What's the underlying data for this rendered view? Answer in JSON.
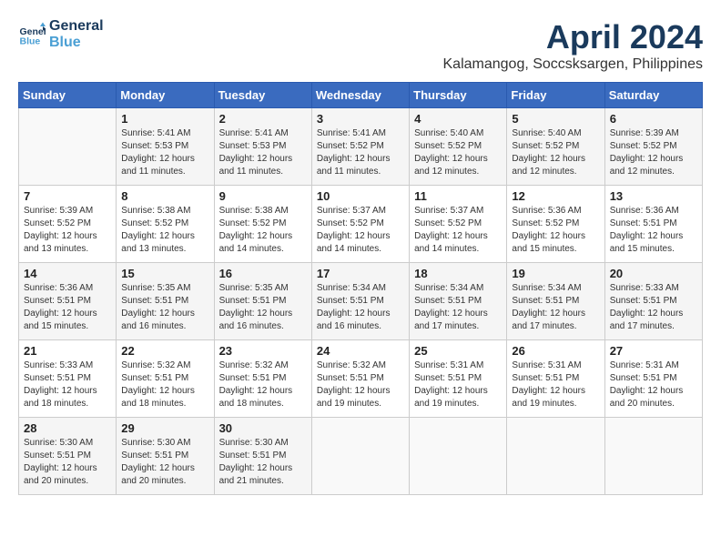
{
  "header": {
    "logo_line1": "General",
    "logo_line2": "Blue",
    "month_year": "April 2024",
    "location": "Kalamangog, Soccsksargen, Philippines"
  },
  "weekdays": [
    "Sunday",
    "Monday",
    "Tuesday",
    "Wednesday",
    "Thursday",
    "Friday",
    "Saturday"
  ],
  "weeks": [
    [
      {
        "day": "",
        "sunrise": "",
        "sunset": "",
        "daylight": ""
      },
      {
        "day": "1",
        "sunrise": "Sunrise: 5:41 AM",
        "sunset": "Sunset: 5:53 PM",
        "daylight": "Daylight: 12 hours and 11 minutes."
      },
      {
        "day": "2",
        "sunrise": "Sunrise: 5:41 AM",
        "sunset": "Sunset: 5:53 PM",
        "daylight": "Daylight: 12 hours and 11 minutes."
      },
      {
        "day": "3",
        "sunrise": "Sunrise: 5:41 AM",
        "sunset": "Sunset: 5:52 PM",
        "daylight": "Daylight: 12 hours and 11 minutes."
      },
      {
        "day": "4",
        "sunrise": "Sunrise: 5:40 AM",
        "sunset": "Sunset: 5:52 PM",
        "daylight": "Daylight: 12 hours and 12 minutes."
      },
      {
        "day": "5",
        "sunrise": "Sunrise: 5:40 AM",
        "sunset": "Sunset: 5:52 PM",
        "daylight": "Daylight: 12 hours and 12 minutes."
      },
      {
        "day": "6",
        "sunrise": "Sunrise: 5:39 AM",
        "sunset": "Sunset: 5:52 PM",
        "daylight": "Daylight: 12 hours and 12 minutes."
      }
    ],
    [
      {
        "day": "7",
        "sunrise": "Sunrise: 5:39 AM",
        "sunset": "Sunset: 5:52 PM",
        "daylight": "Daylight: 12 hours and 13 minutes."
      },
      {
        "day": "8",
        "sunrise": "Sunrise: 5:38 AM",
        "sunset": "Sunset: 5:52 PM",
        "daylight": "Daylight: 12 hours and 13 minutes."
      },
      {
        "day": "9",
        "sunrise": "Sunrise: 5:38 AM",
        "sunset": "Sunset: 5:52 PM",
        "daylight": "Daylight: 12 hours and 14 minutes."
      },
      {
        "day": "10",
        "sunrise": "Sunrise: 5:37 AM",
        "sunset": "Sunset: 5:52 PM",
        "daylight": "Daylight: 12 hours and 14 minutes."
      },
      {
        "day": "11",
        "sunrise": "Sunrise: 5:37 AM",
        "sunset": "Sunset: 5:52 PM",
        "daylight": "Daylight: 12 hours and 14 minutes."
      },
      {
        "day": "12",
        "sunrise": "Sunrise: 5:36 AM",
        "sunset": "Sunset: 5:52 PM",
        "daylight": "Daylight: 12 hours and 15 minutes."
      },
      {
        "day": "13",
        "sunrise": "Sunrise: 5:36 AM",
        "sunset": "Sunset: 5:51 PM",
        "daylight": "Daylight: 12 hours and 15 minutes."
      }
    ],
    [
      {
        "day": "14",
        "sunrise": "Sunrise: 5:36 AM",
        "sunset": "Sunset: 5:51 PM",
        "daylight": "Daylight: 12 hours and 15 minutes."
      },
      {
        "day": "15",
        "sunrise": "Sunrise: 5:35 AM",
        "sunset": "Sunset: 5:51 PM",
        "daylight": "Daylight: 12 hours and 16 minutes."
      },
      {
        "day": "16",
        "sunrise": "Sunrise: 5:35 AM",
        "sunset": "Sunset: 5:51 PM",
        "daylight": "Daylight: 12 hours and 16 minutes."
      },
      {
        "day": "17",
        "sunrise": "Sunrise: 5:34 AM",
        "sunset": "Sunset: 5:51 PM",
        "daylight": "Daylight: 12 hours and 16 minutes."
      },
      {
        "day": "18",
        "sunrise": "Sunrise: 5:34 AM",
        "sunset": "Sunset: 5:51 PM",
        "daylight": "Daylight: 12 hours and 17 minutes."
      },
      {
        "day": "19",
        "sunrise": "Sunrise: 5:34 AM",
        "sunset": "Sunset: 5:51 PM",
        "daylight": "Daylight: 12 hours and 17 minutes."
      },
      {
        "day": "20",
        "sunrise": "Sunrise: 5:33 AM",
        "sunset": "Sunset: 5:51 PM",
        "daylight": "Daylight: 12 hours and 17 minutes."
      }
    ],
    [
      {
        "day": "21",
        "sunrise": "Sunrise: 5:33 AM",
        "sunset": "Sunset: 5:51 PM",
        "daylight": "Daylight: 12 hours and 18 minutes."
      },
      {
        "day": "22",
        "sunrise": "Sunrise: 5:32 AM",
        "sunset": "Sunset: 5:51 PM",
        "daylight": "Daylight: 12 hours and 18 minutes."
      },
      {
        "day": "23",
        "sunrise": "Sunrise: 5:32 AM",
        "sunset": "Sunset: 5:51 PM",
        "daylight": "Daylight: 12 hours and 18 minutes."
      },
      {
        "day": "24",
        "sunrise": "Sunrise: 5:32 AM",
        "sunset": "Sunset: 5:51 PM",
        "daylight": "Daylight: 12 hours and 19 minutes."
      },
      {
        "day": "25",
        "sunrise": "Sunrise: 5:31 AM",
        "sunset": "Sunset: 5:51 PM",
        "daylight": "Daylight: 12 hours and 19 minutes."
      },
      {
        "day": "26",
        "sunrise": "Sunrise: 5:31 AM",
        "sunset": "Sunset: 5:51 PM",
        "daylight": "Daylight: 12 hours and 19 minutes."
      },
      {
        "day": "27",
        "sunrise": "Sunrise: 5:31 AM",
        "sunset": "Sunset: 5:51 PM",
        "daylight": "Daylight: 12 hours and 20 minutes."
      }
    ],
    [
      {
        "day": "28",
        "sunrise": "Sunrise: 5:30 AM",
        "sunset": "Sunset: 5:51 PM",
        "daylight": "Daylight: 12 hours and 20 minutes."
      },
      {
        "day": "29",
        "sunrise": "Sunrise: 5:30 AM",
        "sunset": "Sunset: 5:51 PM",
        "daylight": "Daylight: 12 hours and 20 minutes."
      },
      {
        "day": "30",
        "sunrise": "Sunrise: 5:30 AM",
        "sunset": "Sunset: 5:51 PM",
        "daylight": "Daylight: 12 hours and 21 minutes."
      },
      {
        "day": "",
        "sunrise": "",
        "sunset": "",
        "daylight": ""
      },
      {
        "day": "",
        "sunrise": "",
        "sunset": "",
        "daylight": ""
      },
      {
        "day": "",
        "sunrise": "",
        "sunset": "",
        "daylight": ""
      },
      {
        "day": "",
        "sunrise": "",
        "sunset": "",
        "daylight": ""
      }
    ]
  ]
}
